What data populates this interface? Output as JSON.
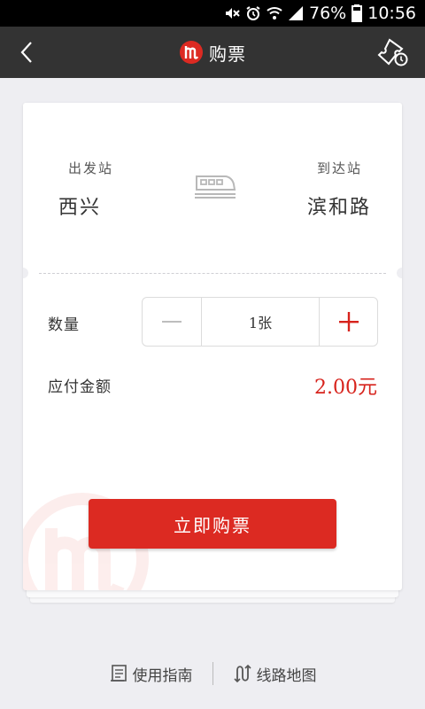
{
  "status_bar": {
    "battery": "76%",
    "time": "10:56"
  },
  "app_bar": {
    "title": "购票"
  },
  "trip": {
    "from_label": "出发站",
    "from_station": "西兴",
    "to_label": "到达站",
    "to_station": "滨和路"
  },
  "quantity": {
    "label": "数量",
    "value": "1张"
  },
  "payment": {
    "label": "应付金额",
    "amount": "2.00元"
  },
  "buy_button": {
    "label": "立即购票"
  },
  "bottom_links": {
    "guide": "使用指南",
    "route_map": "线路地图"
  },
  "colors": {
    "accent": "#dc2a22",
    "app_bar": "#333333",
    "background": "#eeeef2"
  }
}
